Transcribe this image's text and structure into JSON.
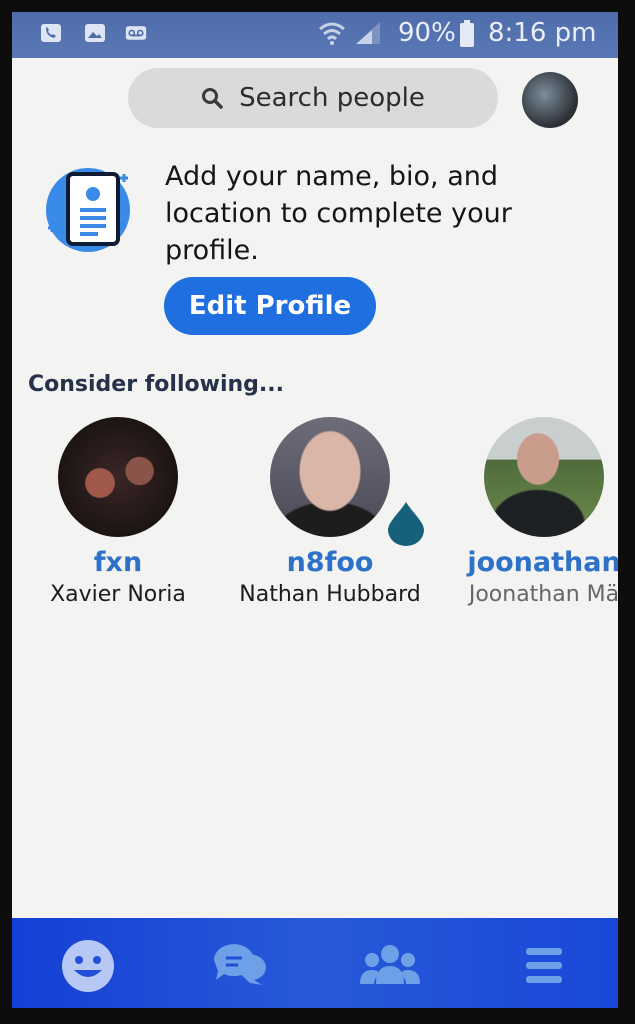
{
  "status_bar": {
    "battery": "90%",
    "time": "8:16 pm",
    "icons": [
      "phone-icon",
      "image-icon",
      "voicemail-icon",
      "wifi-icon",
      "signal-icon",
      "battery-icon"
    ]
  },
  "search": {
    "placeholder": "Search people"
  },
  "profile_prompt": {
    "text": "Add your name, bio, and location to complete your profile.",
    "button": "Edit Profile"
  },
  "suggestions": {
    "heading": "Consider following...",
    "people": [
      {
        "username": "fxn",
        "name": "Xavier Noria"
      },
      {
        "username": "n8foo",
        "name": "Nathan Hubbard"
      },
      {
        "username": "joonathan",
        "name": "Joonathan Mä"
      }
    ]
  },
  "bottom_nav": {
    "items": [
      "smiley-icon",
      "chat-icon",
      "people-icon",
      "menu-icon"
    ]
  },
  "colors": {
    "accent": "#1f6fe0",
    "nav": "#1f4fd8",
    "username": "#2d71c8"
  }
}
